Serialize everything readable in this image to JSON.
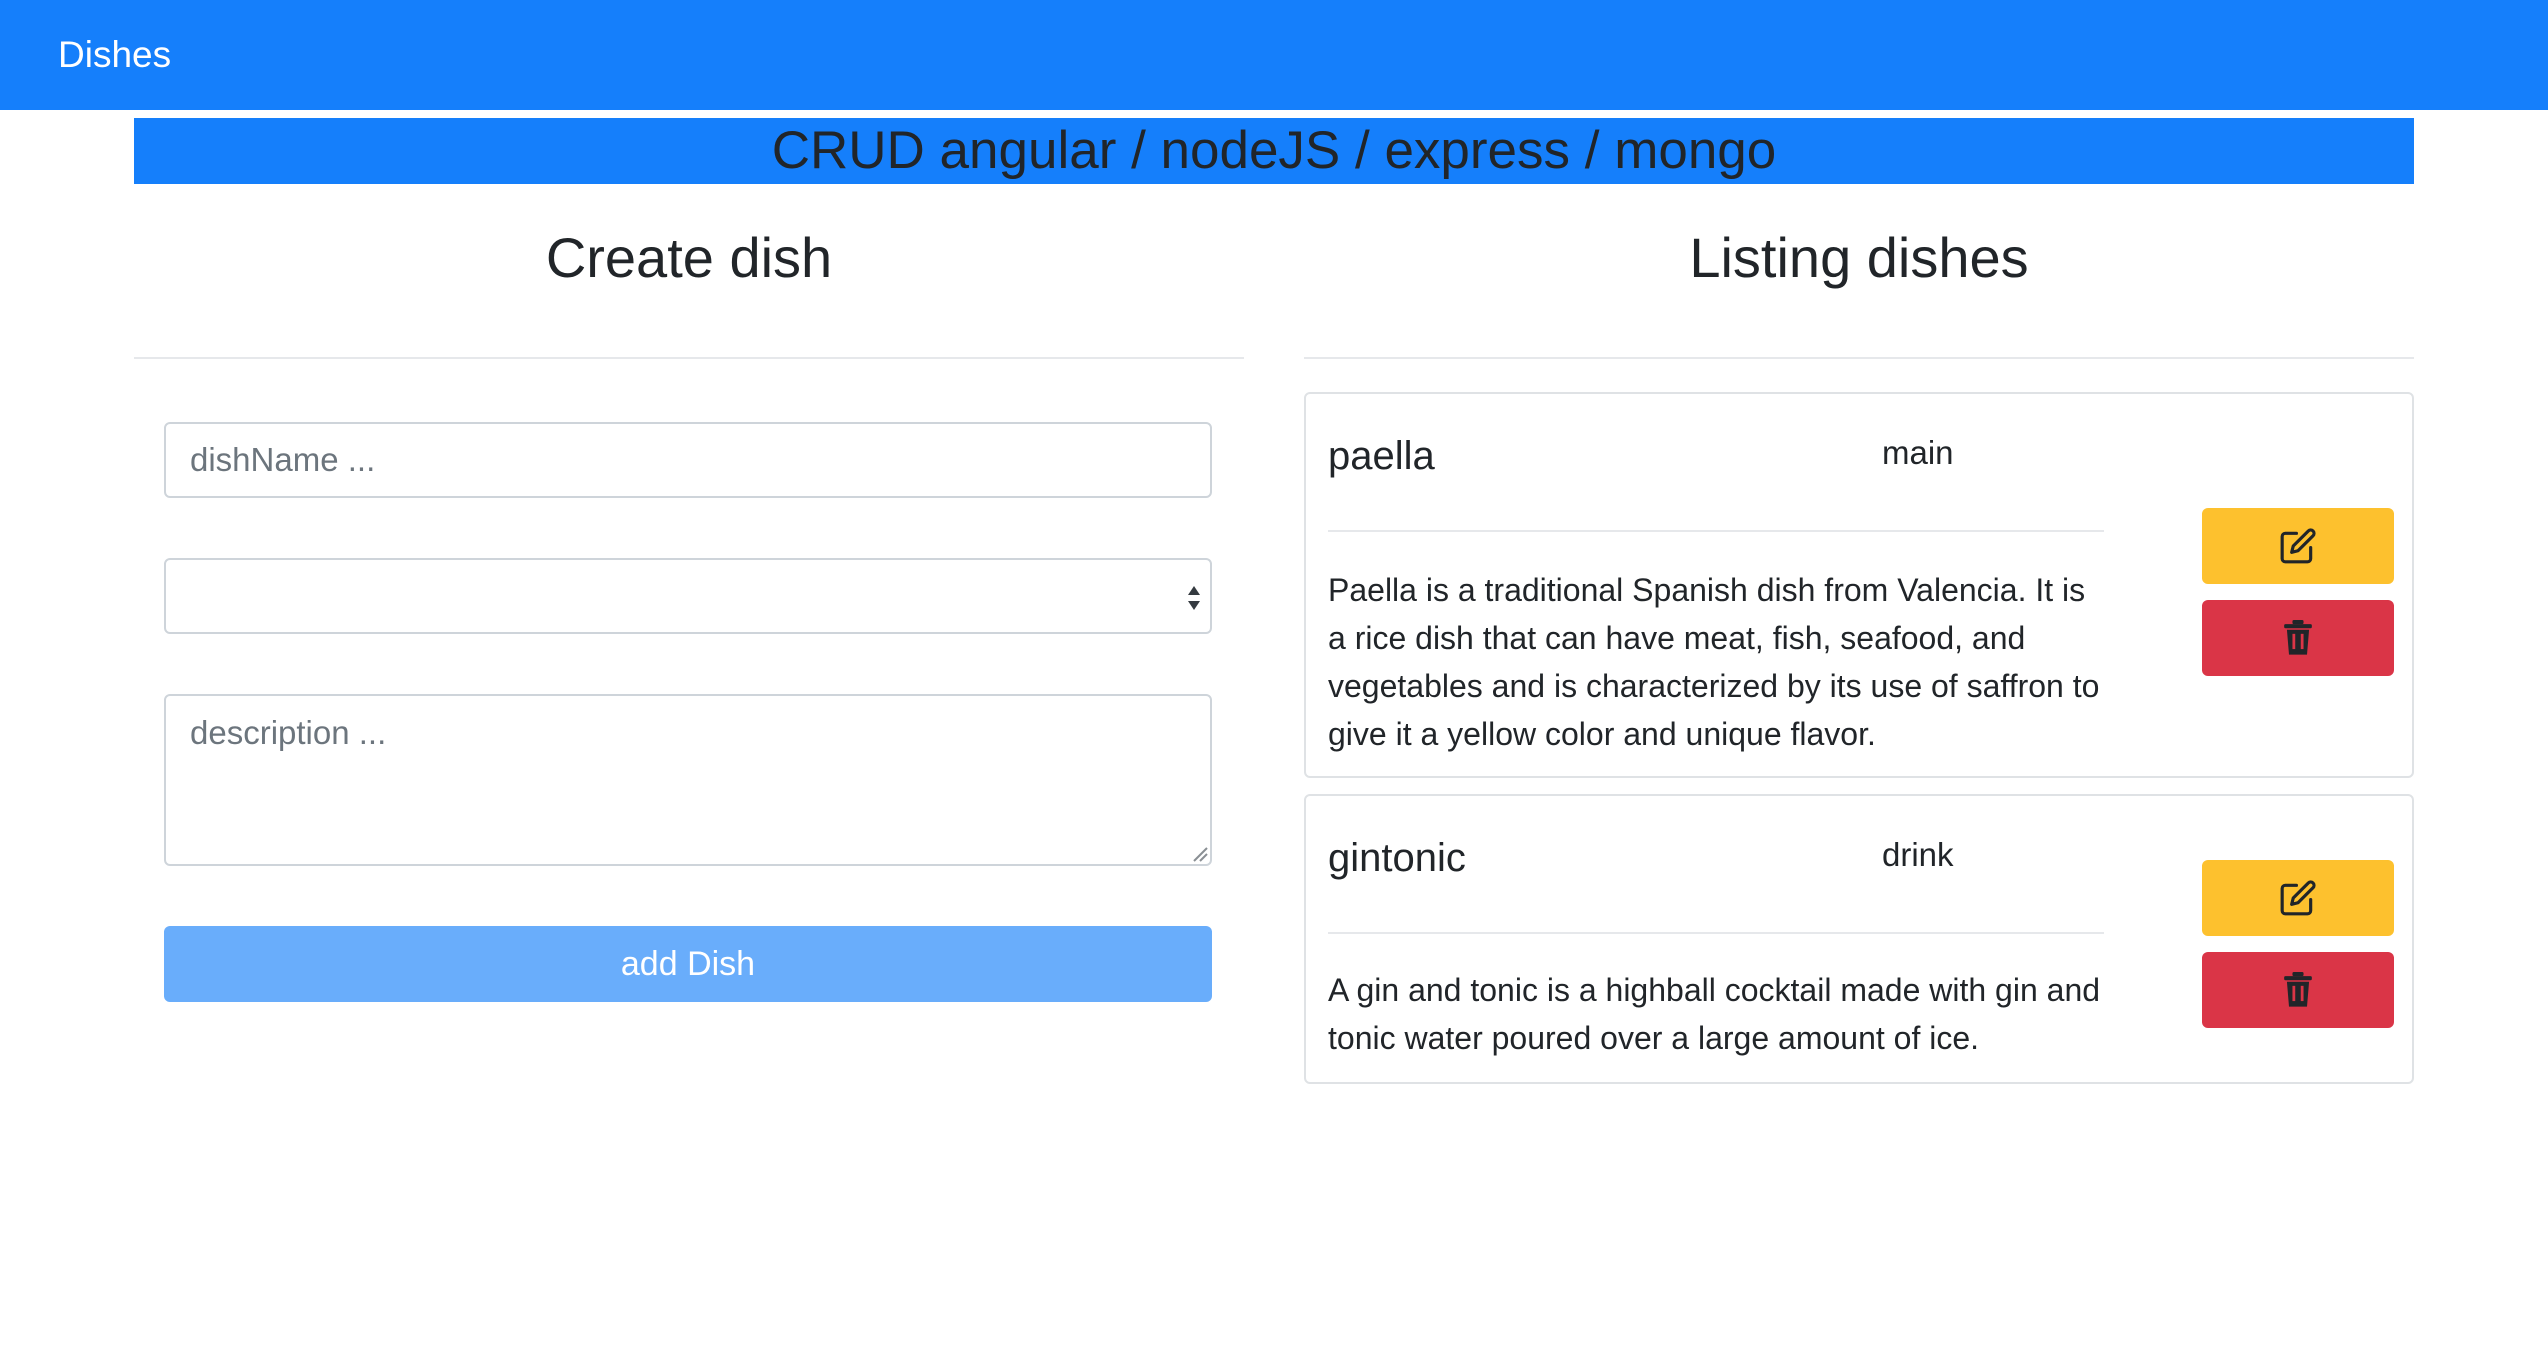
{
  "navbar": {
    "brand": "Dishes"
  },
  "banner": {
    "title": "CRUD angular / nodeJS / express / mongo"
  },
  "create": {
    "title": "Create dish",
    "name_placeholder": "dishName ...",
    "category_value": "",
    "description_placeholder": "description ...",
    "add_button": "add Dish"
  },
  "listing": {
    "title": "Listing dishes",
    "dishes": [
      {
        "name": "paella",
        "category": "main",
        "description": "Paella is a traditional Spanish dish from Valencia. It is a rice dish that can have meat, fish, seafood, and vegetables and is characterized by its use of saffron to give it a yellow color and unique flavor."
      },
      {
        "name": "gintonic",
        "category": "drink",
        "description": "A gin and tonic is a highball cocktail made with gin and tonic water poured over a large amount of ice."
      }
    ]
  },
  "icons": {
    "edit": "edit-icon",
    "delete": "trash-icon"
  },
  "colors": {
    "primary": "#157ffb",
    "primary_disabled": "#69adfb",
    "warning": "#fdc12e",
    "danger": "#da3547"
  }
}
